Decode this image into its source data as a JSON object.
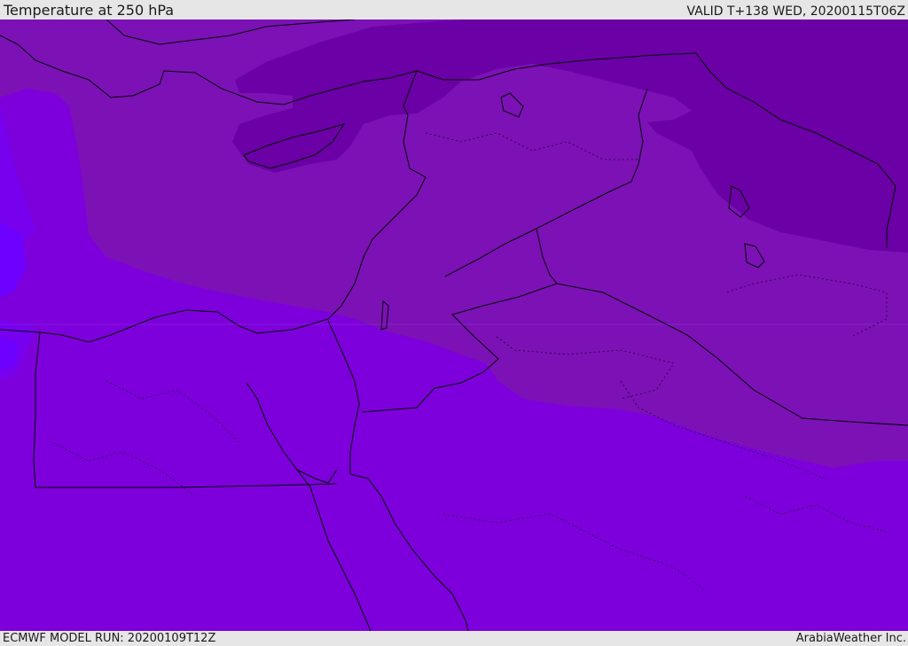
{
  "header": {
    "title": "Temperature at 250 hPa",
    "valid": "VALID T+138 WED, 20200115T06Z"
  },
  "footer": {
    "model_run": "ECMWF MODEL RUN: 20200109T12Z",
    "credit": "ArabiaWeather Inc."
  },
  "map": {
    "colors": {
      "band_coldest": "#6b00a6",
      "band_cold": "#7c11b6",
      "band_base": "#7d00dc",
      "band_warm": "#7700ee",
      "band_warmer": "#6e00ff",
      "borders": "#000000"
    }
  }
}
